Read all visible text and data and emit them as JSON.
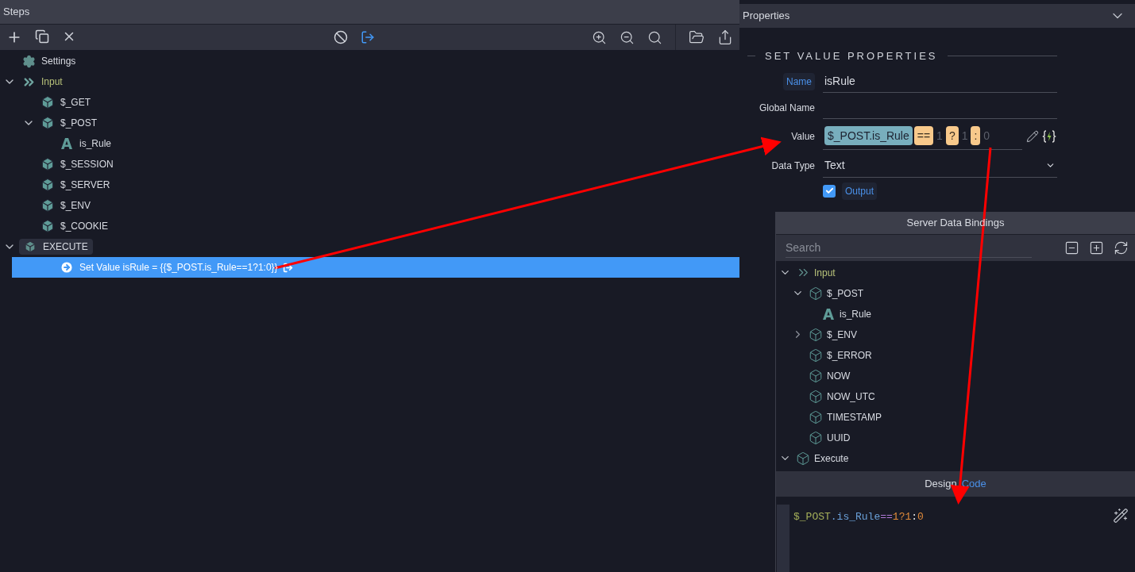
{
  "steps_panel": {
    "title": "Steps",
    "tree": [
      {
        "label": "Settings",
        "kind": "settings",
        "selected": false
      },
      {
        "label": "Input",
        "kind": "group",
        "expanded": true,
        "selected": false,
        "children": [
          {
            "label": "$_GET",
            "kind": "object",
            "selected": false
          },
          {
            "label": "$_POST",
            "kind": "object",
            "expanded": true,
            "selected": false,
            "children": [
              {
                "label": "is_Rule",
                "kind": "field",
                "selected": false
              }
            ]
          },
          {
            "label": "$_SESSION",
            "kind": "object",
            "selected": false
          },
          {
            "label": "$_SERVER",
            "kind": "object",
            "selected": false
          },
          {
            "label": "$_ENV",
            "kind": "object",
            "selected": false
          },
          {
            "label": "$_COOKIE",
            "kind": "object",
            "selected": false
          }
        ]
      },
      {
        "label": "EXECUTE",
        "kind": "section",
        "expanded": true,
        "selected": false,
        "children": [
          {
            "label": "Set Value isRule = {{$_POST.is_Rule==1?1:0}}",
            "kind": "step",
            "selected": true
          }
        ]
      }
    ]
  },
  "properties_panel": {
    "title": "Properties",
    "section": "SET VALUE PROPERTIES",
    "name": {
      "label": "Name",
      "value": "isRule"
    },
    "global_name": {
      "label": "Global Name"
    },
    "value": {
      "label": "Value",
      "tokens": [
        {
          "text": "$_POST.is_Rule",
          "kind": "path"
        },
        {
          "text": "==",
          "kind": "operator"
        },
        {
          "text": "1",
          "kind": "literal"
        },
        {
          "text": "?",
          "kind": "operator"
        },
        {
          "text": "1",
          "kind": "literal"
        },
        {
          "text": ":",
          "kind": "operator"
        },
        {
          "text": "0",
          "kind": "literal"
        }
      ]
    },
    "data_type": {
      "label": "Data Type",
      "value": "Text"
    },
    "output": {
      "label": "Output",
      "checked": true
    }
  },
  "bindings_panel": {
    "title": "Server Data Bindings",
    "search": {
      "placeholder": "Search"
    },
    "tree": [
      {
        "label": "Input",
        "kind": "group",
        "expanded": true,
        "children": [
          {
            "label": "$_POST",
            "kind": "object",
            "expanded": true,
            "children": [
              {
                "label": "is_Rule",
                "kind": "field"
              }
            ]
          },
          {
            "label": "$_ENV",
            "kind": "object",
            "expanded": false
          },
          {
            "label": "$_ERROR",
            "kind": "object"
          },
          {
            "label": "NOW",
            "kind": "object"
          },
          {
            "label": "NOW_UTC",
            "kind": "object"
          },
          {
            "label": "TIMESTAMP",
            "kind": "object"
          },
          {
            "label": "UUID",
            "kind": "object"
          }
        ]
      },
      {
        "label": "Execute",
        "kind": "object",
        "expanded": true
      }
    ]
  },
  "editor": {
    "tabs": [
      {
        "label": "Design",
        "selected": false
      },
      {
        "label": "Code",
        "selected": true
      }
    ],
    "code": [
      {
        "text": "$_POST",
        "kind": "variable"
      },
      {
        "text": ".is_Rule",
        "kind": "property"
      },
      {
        "text": "==",
        "kind": "operator"
      },
      {
        "text": "1",
        "kind": "number"
      },
      {
        "text": "?",
        "kind": "number"
      },
      {
        "text": "1",
        "kind": "number"
      },
      {
        "text": ":",
        "kind": "punctuation"
      },
      {
        "text": "0",
        "kind": "number"
      }
    ]
  }
}
